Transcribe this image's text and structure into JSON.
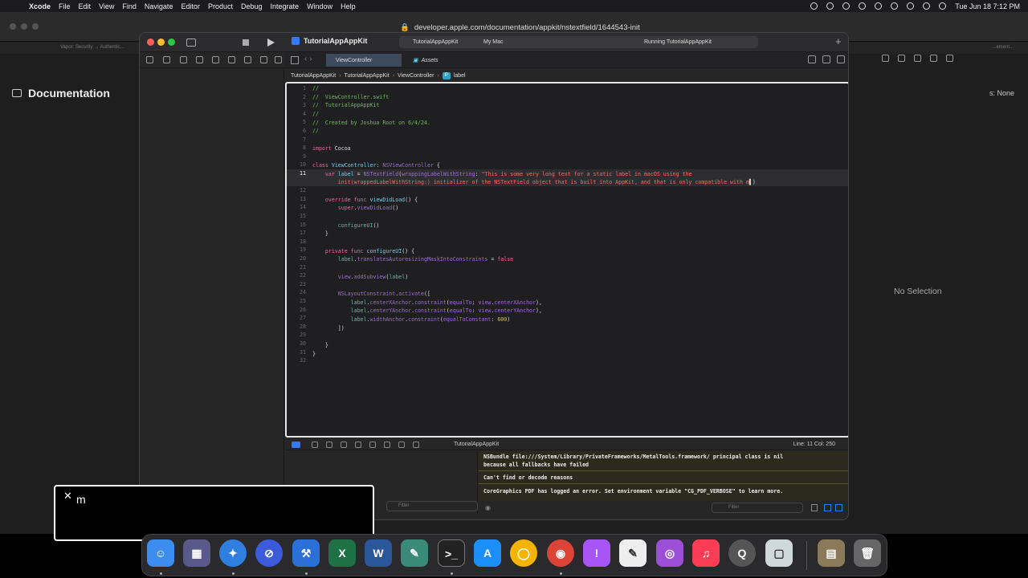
{
  "menubar": {
    "app": "Xcode",
    "items": [
      "File",
      "Edit",
      "View",
      "Find",
      "Navigate",
      "Editor",
      "Product",
      "Debug",
      "Integrate",
      "Window",
      "Help"
    ],
    "datetime": "Tue Jun 18  7:12 PM"
  },
  "safari": {
    "url": "developer.apple.com/documentation/appkit/nstextfield/1644543-init",
    "tab_left": "Vapor: Security → Authentic...",
    "tab_right": "...ement...",
    "doc_title": "Documentation",
    "doc_right": "s: None"
  },
  "xcode": {
    "project": "TutorialAppAppKit",
    "scheme_app": "TutorialAppAppKit",
    "scheme_dest": "My Mac",
    "status": "Running TutorialAppAppKit",
    "tab_active": "ViewController",
    "tab_second": "Assets",
    "breadcrumb": [
      "TutorialAppAppKit",
      "TutorialAppAppKit",
      "ViewController",
      "label"
    ],
    "breadcrumb_badge": "P",
    "inspector_empty": "No Selection",
    "debug_target": "TutorialAppAppKit",
    "cursor_pos": "Line: 11  Col: 250",
    "filter_placeholder": "Filter",
    "console_filter_placeholder": "Filter",
    "console": [
      "NSBundle file:///System/Library/PrivateFrameworks/MetalTools.framework/ principal class is nil",
      "because all fallbacks have failed",
      "Can't find or decode reasons",
      "CoreGraphics PDF has logged an error. Set environment variable \"CG_PDF_VERBOSE\" to learn more."
    ]
  },
  "code": {
    "line_numbers": [
      "1",
      "2",
      "3",
      "4",
      "5",
      "6",
      "7",
      "8",
      "9",
      "10",
      "11",
      "",
      "12",
      "13",
      "14",
      "15",
      "16",
      "17",
      "18",
      "19",
      "20",
      "21",
      "22",
      "23",
      "24",
      "25",
      "26",
      "27",
      "28",
      "29",
      "30",
      "31",
      "32"
    ],
    "current_line": "11"
  },
  "keystroke": {
    "key": "m"
  },
  "dock": {
    "apps": [
      "Finder",
      "Launchpad",
      "Safari",
      "Do Not Disturb",
      "Xcode",
      "Excel",
      "Word",
      "Script Editor",
      "Terminal",
      "App Store",
      "Chrome App",
      "Google Chrome",
      "Feedback",
      "TextEdit",
      "Podcasts",
      "Music",
      "QuickTime",
      "Preview",
      "Photo",
      "Trash"
    ]
  },
  "colors": {
    "accent": "#3478f6",
    "comment": "#6bbf59",
    "keyword": "#fc5fa3",
    "type": "#5dd8ff",
    "string": "#fc6a5d",
    "number": "#d0bf69",
    "console_bg": "#2c2a1c"
  }
}
